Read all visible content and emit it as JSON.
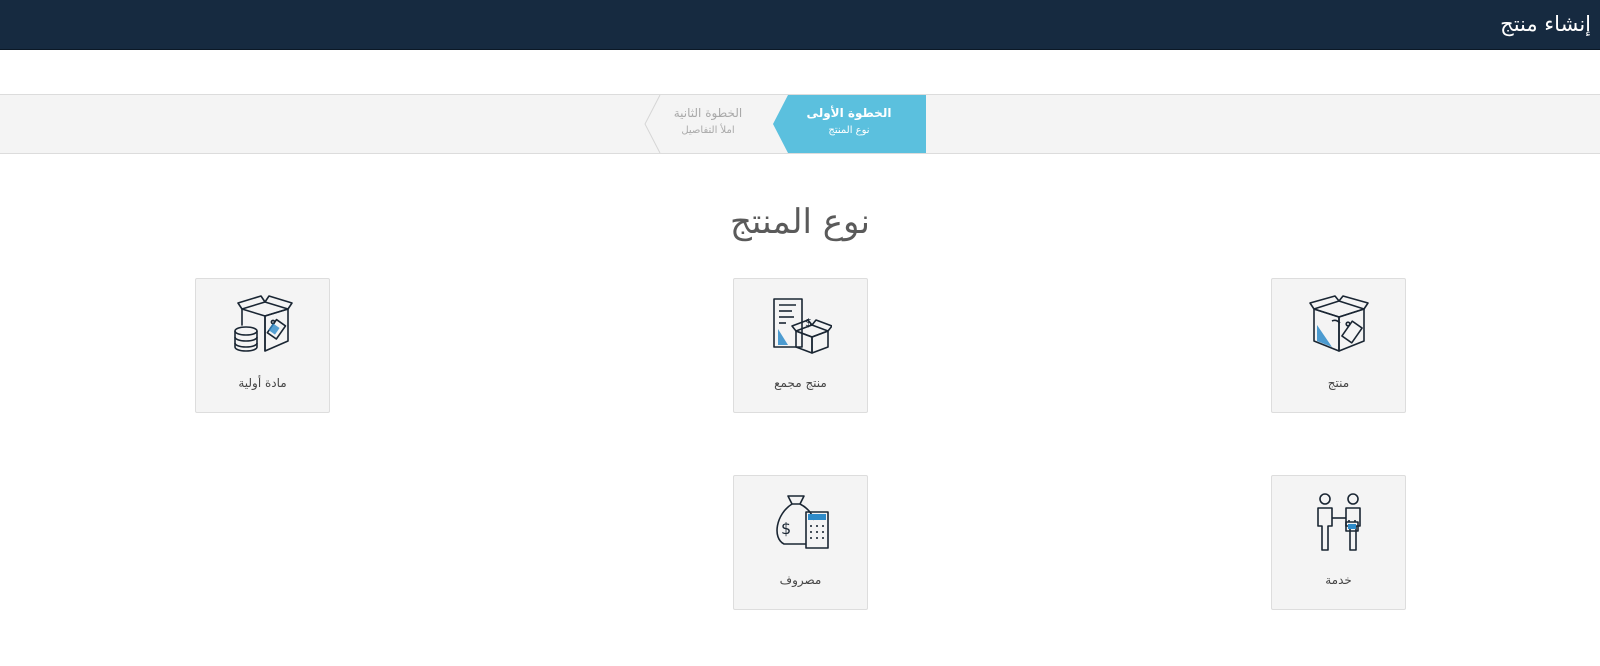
{
  "header": {
    "title": "إنشاء منتج"
  },
  "wizard": {
    "steps": [
      {
        "title": "الخطوة الأولى",
        "subtitle": "نوع المنتج",
        "active": true
      },
      {
        "title": "الخطوة الثانية",
        "subtitle": "املأ التفاصيل",
        "active": false
      }
    ],
    "active_color": "#5bc0de"
  },
  "section": {
    "title": "نوع المنتج"
  },
  "product_types": [
    {
      "label": "منتج",
      "icon": "box-with-tag-icon"
    },
    {
      "label": "منتج مجمع",
      "icon": "document-and-box-icon"
    },
    {
      "label": "مادة أولية",
      "icon": "box-with-coins-icon"
    },
    {
      "label": "خدمة",
      "icon": "handshake-people-icon"
    },
    {
      "label": "مصروف",
      "icon": "money-bag-calculator-icon"
    }
  ],
  "colors": {
    "header_bg": "#162a40",
    "icon_accent": "#2e8bc9",
    "card_bg": "#f4f4f4"
  }
}
